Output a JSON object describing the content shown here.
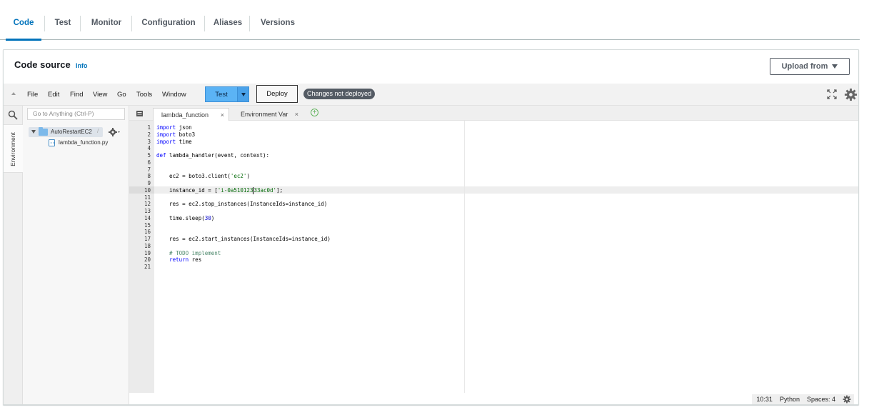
{
  "tabs": [
    {
      "label": "Code",
      "active": true
    },
    {
      "label": "Test"
    },
    {
      "label": "Monitor"
    },
    {
      "label": "Configuration"
    },
    {
      "label": "Aliases"
    },
    {
      "label": "Versions"
    }
  ],
  "panel": {
    "title": "Code source",
    "info": "Info",
    "upload_label": "Upload from"
  },
  "menu": [
    "File",
    "Edit",
    "Find",
    "View",
    "Go",
    "Tools",
    "Window"
  ],
  "toolbar": {
    "test_label": "Test",
    "deploy_label": "Deploy",
    "status_badge": "Changes not deployed"
  },
  "rail": {
    "environment_label": "Environment"
  },
  "tree": {
    "goto_placeholder": "Go to Anything (Ctrl-P)",
    "folder": "AutoRestartEC2",
    "folder_suffix": "/",
    "file": "lambda_function.py"
  },
  "editor_tabs": [
    {
      "label": "lambda_function",
      "close": "×",
      "active": true
    },
    {
      "label": "Environment Var",
      "close": "×",
      "active": false
    }
  ],
  "add_tab": "+",
  "code_lines": [
    [
      {
        "t": "import",
        "c": "kw"
      },
      {
        "t": " json"
      }
    ],
    [
      {
        "t": "import",
        "c": "kw"
      },
      {
        "t": " boto3"
      }
    ],
    [
      {
        "t": "import",
        "c": "kw"
      },
      {
        "t": " time"
      }
    ],
    [],
    [
      {
        "t": "def",
        "c": "kw"
      },
      {
        "t": " lambda_handler(event, context):"
      }
    ],
    [],
    [],
    [
      {
        "t": "    ec2 = boto3.client("
      },
      {
        "t": "'ec2'",
        "c": "str"
      },
      {
        "t": ")"
      }
    ],
    [],
    [
      {
        "t": "    instance_id = ["
      },
      {
        "t": "'i-0a510123",
        "c": "str"
      },
      {
        "t": "|",
        "c": "cur"
      },
      {
        "t": "33ac0d'",
        "c": "str"
      },
      {
        "t": "];"
      }
    ],
    [],
    [
      {
        "t": "    res = ec2.stop_instances(InstanceIds=instance_id)"
      }
    ],
    [],
    [
      {
        "t": "    time.sleep("
      },
      {
        "t": "30",
        "c": "num"
      },
      {
        "t": ")"
      }
    ],
    [],
    [],
    [
      {
        "t": "    res = ec2.start_instances(InstanceIds=instance_id)"
      }
    ],
    [],
    [
      {
        "t": "    # TODO implement",
        "c": "cm"
      }
    ],
    [
      {
        "t": "    "
      },
      {
        "t": "return",
        "c": "kw"
      },
      {
        "t": " res"
      }
    ],
    []
  ],
  "status_bar": {
    "position": "10:31",
    "language": "Python",
    "indent": "Spaces: 4"
  },
  "colors": {
    "accent": "#0073bb",
    "test_button": "#5bb3f5",
    "badge_bg": "#545b64"
  }
}
